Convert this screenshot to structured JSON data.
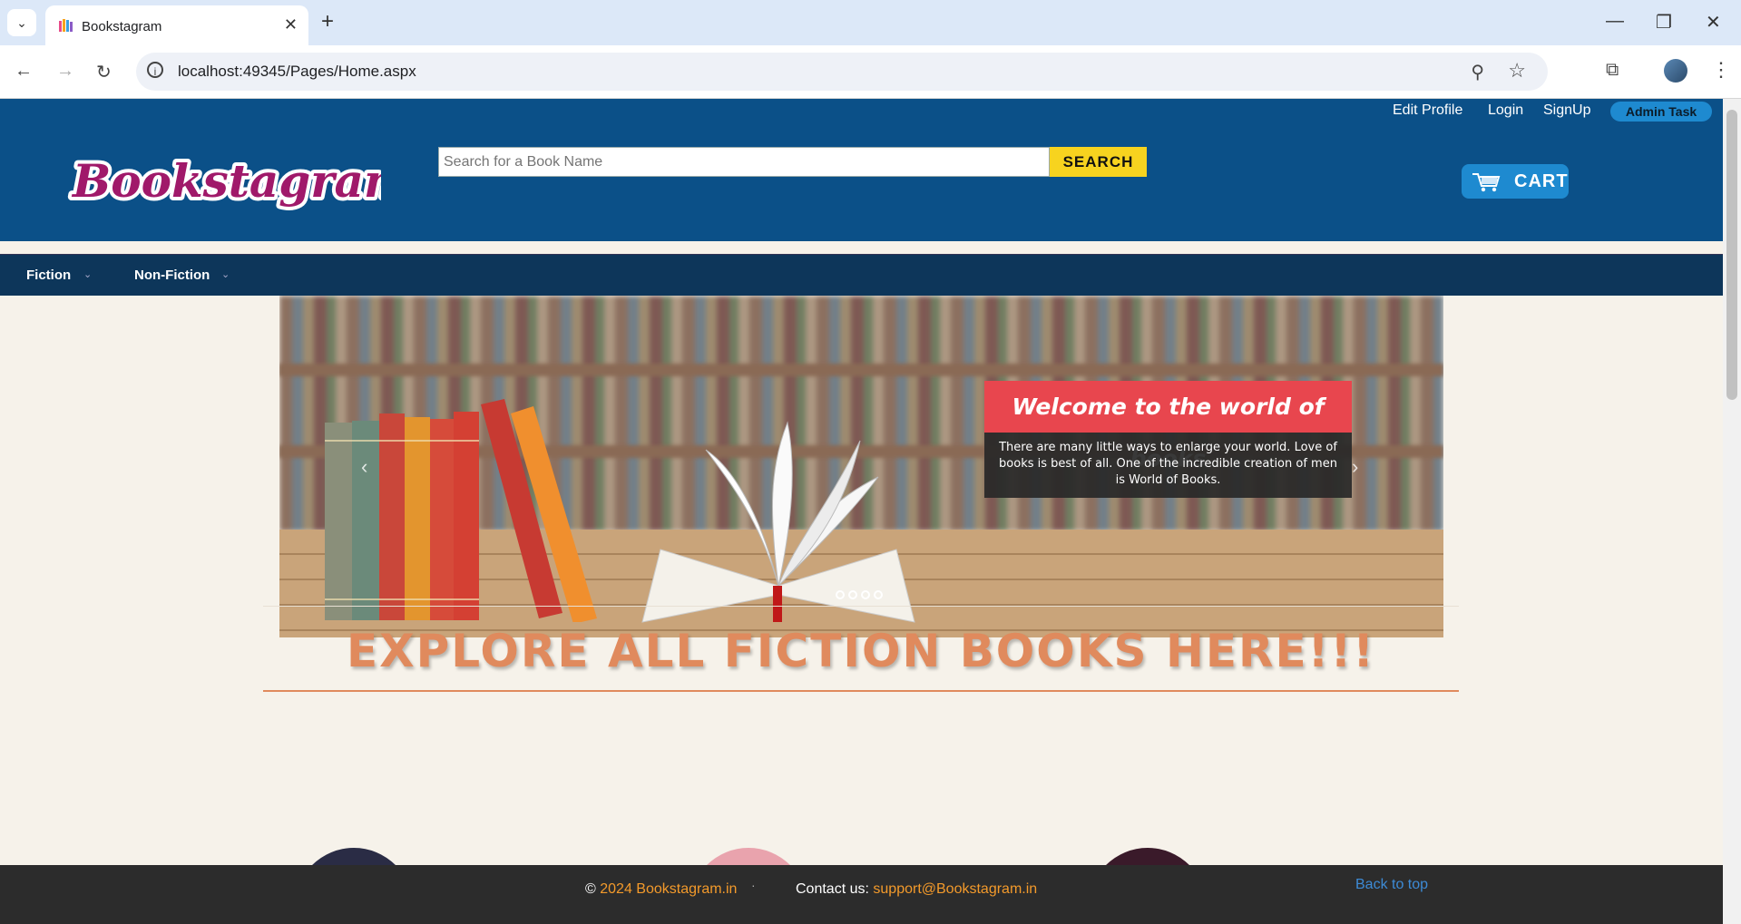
{
  "browser": {
    "tab_title": "Bookstagram",
    "url": "localhost:49345/Pages/Home.aspx",
    "icons": [
      "tab-list-icon",
      "close-icon",
      "new-tab-icon",
      "minimize-icon",
      "restore-icon",
      "back-icon",
      "forward-icon",
      "reload-icon",
      "site-info-icon",
      "zoom-icon",
      "star-icon",
      "extensions-icon",
      "profile-avatar",
      "menu-icon"
    ]
  },
  "header": {
    "top_links": [
      "Edit Profile",
      "Login",
      "SignUp"
    ],
    "admin_label": "Admin Task",
    "logo_text": "Bookstagram",
    "search_placeholder": "Search for a Book Name",
    "search_label": "SEARCH",
    "cart_label": "CART"
  },
  "menu": {
    "items": [
      "Fiction",
      "Non-Fiction"
    ]
  },
  "slider": {
    "caption_title": "Welcome to the world of books",
    "caption_body": "There are many little ways to enlarge your world. Love of books is best of all. One of the incredible creation of men is World of Books.",
    "prev": "‹",
    "next": "›",
    "slide_count": 4
  },
  "section": {
    "title": "EXPLORE ALL FICTION BOOKS HERE!!!"
  },
  "footer": {
    "copyright_symbol": "©",
    "copyright_link": "2024 Bookstagram.in",
    "separator": "·",
    "contact_label": "Contact us:",
    "contact_email": "support@Bookstagram.in",
    "back_to_top": "Back to top"
  },
  "colors": {
    "header_bg": "#0b5088",
    "menu_bg": "#0d365a",
    "search_button": "#f7d31f",
    "accent_title": "#e08a5d",
    "caption_red": "#e8464e"
  }
}
